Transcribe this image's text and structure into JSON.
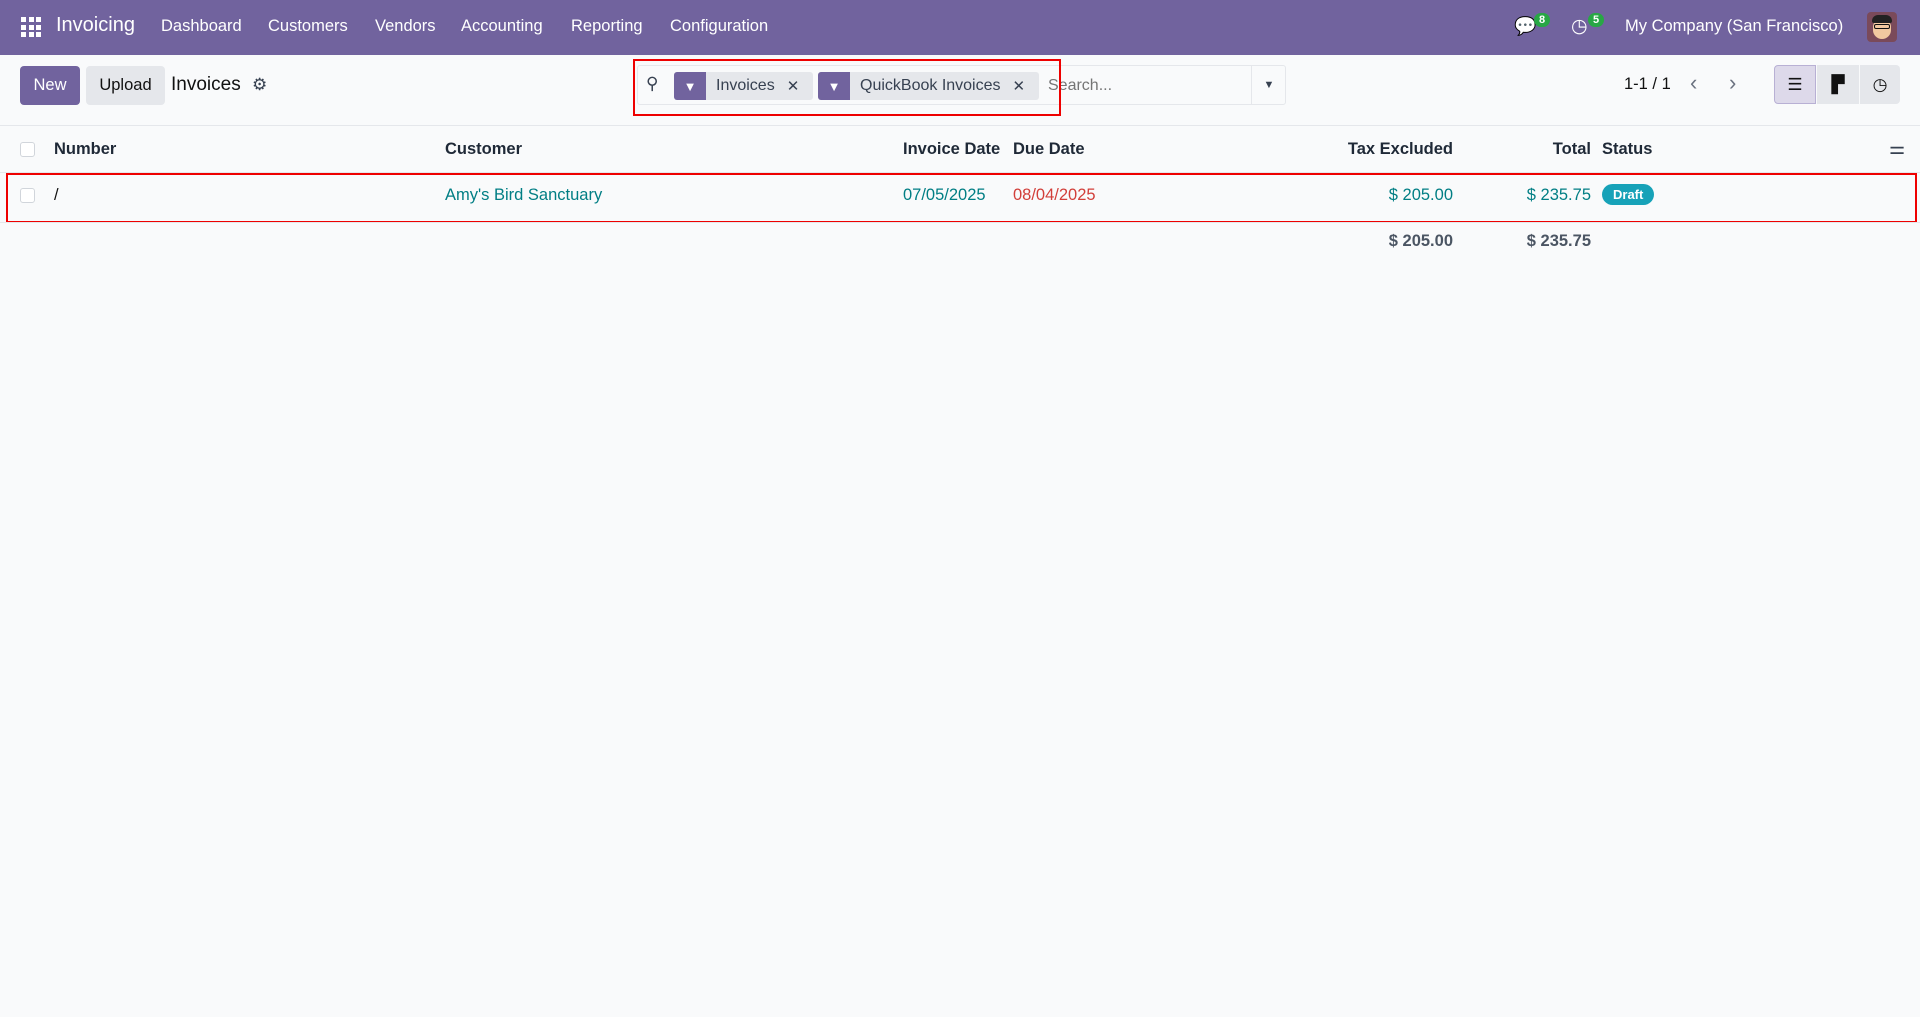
{
  "nav": {
    "app": "Invoicing",
    "menu": [
      "Dashboard",
      "Customers",
      "Vendors",
      "Accounting",
      "Reporting",
      "Configuration"
    ],
    "messages_count": "8",
    "activities_count": "5",
    "company": "My Company (San Francisco)"
  },
  "control": {
    "new": "New",
    "upload": "Upload",
    "title": "Invoices",
    "facets": [
      "Invoices",
      "QuickBook Invoices"
    ],
    "search_placeholder": "Search...",
    "pager": "1-1 / 1"
  },
  "table": {
    "headers": {
      "number": "Number",
      "customer": "Customer",
      "invoice_date": "Invoice Date",
      "due_date": "Due Date",
      "tax_excluded": "Tax Excluded",
      "total": "Total",
      "status": "Status"
    },
    "rows": [
      {
        "number": "/",
        "customer": "Amy's Bird Sanctuary",
        "invoice_date": "07/05/2025",
        "due_date": "08/04/2025",
        "tax_excluded": "$ 205.00",
        "total": "$ 235.75",
        "status": "Draft"
      }
    ],
    "totals": {
      "tax_excluded": "$ 205.00",
      "total": "$ 235.75"
    }
  },
  "colors": {
    "brand": "#71639e",
    "link": "#017e84",
    "overdue": "#d23f3a",
    "draft": "#17a2b8"
  }
}
